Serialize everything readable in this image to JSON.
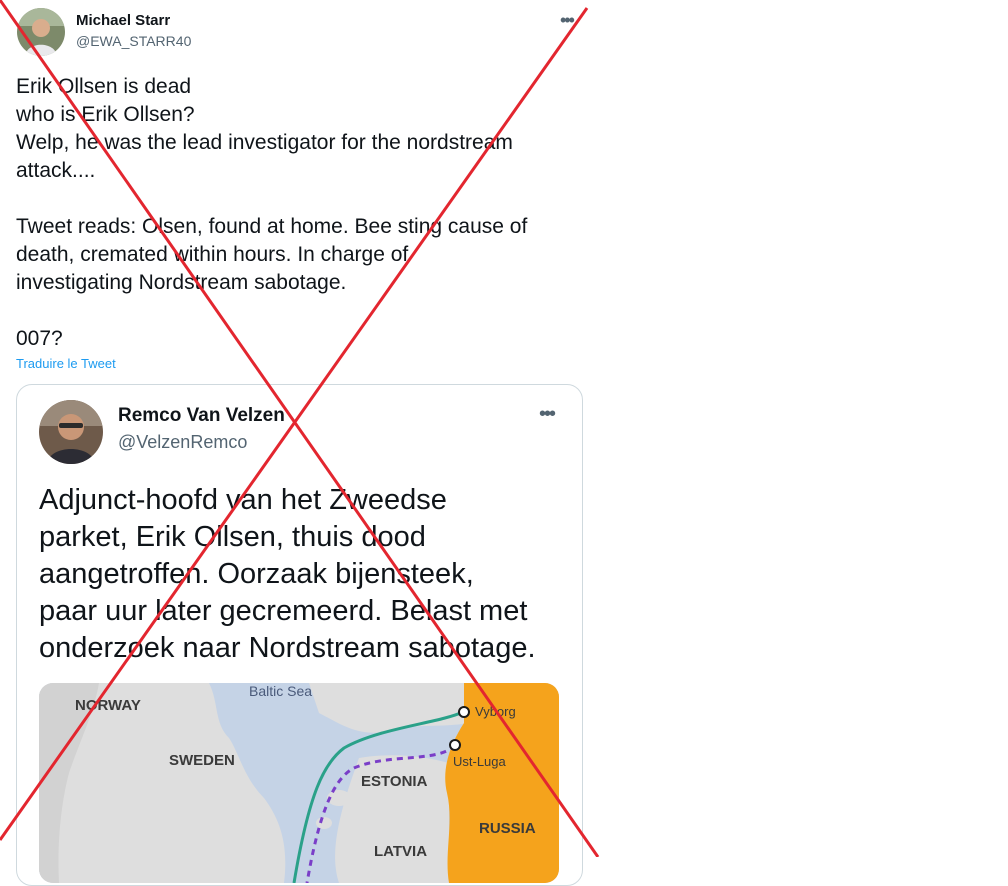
{
  "tweet": {
    "author": {
      "name": "Michael Starr",
      "handle": "@EWA_STARR40"
    },
    "more_icon": "more-horizontal-icon",
    "text_lines": [
      "Erik Ollsen is dead",
      "who is Erik Ollsen?",
      "Welp, he was the lead investigator for the nordstream",
      "attack....",
      "Tweet reads: Olsen, found at home. Bee sting cause of",
      "death, cremated within hours. In charge of",
      "investigating Nordstream sabotage.",
      "007?"
    ],
    "translate_link": "Traduire le Tweet"
  },
  "quoted_tweet": {
    "author": {
      "name": "Remco Van Velzen",
      "handle": "@VelzenRemco"
    },
    "text_lines": [
      "Adjunct-hoofd van het Zweedse",
      "parket, Erik Ollsen, thuis dood",
      "aangetroffen. Oorzaak bijensteek,",
      "paar uur later gecremeerd. Belast met",
      "onderzoek naar Nordstream sabotage."
    ],
    "map": {
      "sea_label": "Baltic Sea",
      "countries": [
        "NORWAY",
        "SWEDEN",
        "ESTONIA",
        "RUSSIA",
        "LATVIA"
      ],
      "cities": [
        "Vyborg",
        "Ust-Luga"
      ],
      "colors": {
        "sea": "#c5d3e6",
        "land": "#dedede",
        "russia": "#f5a31c",
        "pipeline_solid": "#2aa189",
        "pipeline_dashed": "#7a3ec8"
      }
    }
  },
  "overlay": {
    "type": "red-cross",
    "color": "#e3262f"
  }
}
